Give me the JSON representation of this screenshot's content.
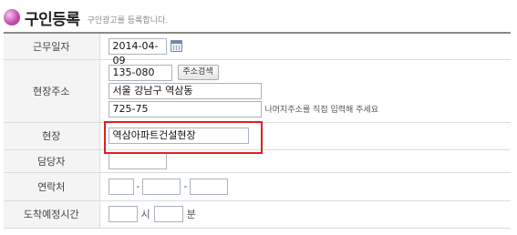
{
  "header": {
    "title": "구인등록",
    "subtitle": "구인광고를 등록합니다."
  },
  "form": {
    "work_date": {
      "label": "근무일자",
      "value": "2014-04-09"
    },
    "site_address": {
      "label": "현장주소",
      "zipcode": "135-080",
      "search_button": "주소검색",
      "address1": "서울 강남구 역삼동",
      "address2": "725-75",
      "address2_hint": "나머지주소를 직접 입력해 주세요"
    },
    "site": {
      "label": "현장",
      "value": "역삼아파트건설현장"
    },
    "manager": {
      "label": "담당자",
      "value": ""
    },
    "contact": {
      "label": "연락처",
      "part1": "",
      "part2": "",
      "part3": "",
      "separator": "-"
    },
    "arrival_time": {
      "label": "도착예정시간",
      "hour": "",
      "hour_unit": "시",
      "minute": "",
      "minute_unit": "분"
    }
  },
  "colors": {
    "highlight": "#e02020",
    "title_icon": "#c74db3"
  }
}
